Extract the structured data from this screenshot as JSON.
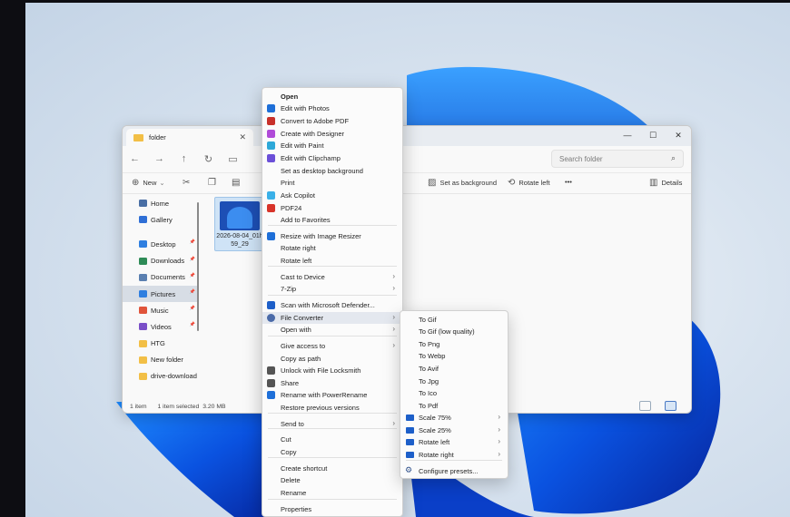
{
  "explorer": {
    "tab_title": "folder",
    "search_placeholder": "Search folder",
    "toolbar": {
      "new_label": "New",
      "set_background_label": "Set as background",
      "rotate_left_label": "Rotate left",
      "more_label": "•••",
      "details_label": "Details"
    },
    "sidebar": {
      "items": [
        {
          "label": "Home",
          "icon": "home-icon",
          "color": "#4a6fa5",
          "pinned": false
        },
        {
          "label": "Gallery",
          "icon": "gallery-icon",
          "color": "#2f6fd6",
          "pinned": false
        },
        {
          "label": "Desktop",
          "icon": "desktop-icon",
          "color": "#2f7fe0",
          "pinned": true
        },
        {
          "label": "Downloads",
          "icon": "download-icon",
          "color": "#2e8b57",
          "pinned": true
        },
        {
          "label": "Documents",
          "icon": "documents-icon",
          "color": "#5a7fb0",
          "pinned": true
        },
        {
          "label": "Pictures",
          "icon": "pictures-icon",
          "color": "#2f7fe0",
          "pinned": true,
          "active": true
        },
        {
          "label": "Music",
          "icon": "music-icon",
          "color": "#e0543a",
          "pinned": true
        },
        {
          "label": "Videos",
          "icon": "videos-icon",
          "color": "#7a4fc8",
          "pinned": true
        },
        {
          "label": "HTG",
          "icon": "folder-icon",
          "color": "#f2bf46",
          "pinned": false
        },
        {
          "label": "New folder",
          "icon": "folder-icon",
          "color": "#f2bf46",
          "pinned": false
        },
        {
          "label": "drive-download",
          "icon": "folder-icon",
          "color": "#f2bf46",
          "pinned": false
        }
      ]
    },
    "file": {
      "name_line1": "2026-08-04_01h",
      "name_line2": "59_29"
    },
    "status": {
      "count": "1 item",
      "selected": "1 item selected",
      "size": "3.20 MB"
    }
  },
  "context_menu": {
    "items": [
      {
        "label": "Open",
        "bold": true,
        "icon": "",
        "color": ""
      },
      {
        "label": "Edit with Photos",
        "icon": "photos-icon",
        "color": "#1e6fd8"
      },
      {
        "label": "Convert to Adobe PDF",
        "icon": "adobe-pdf-icon",
        "color": "#c8302a"
      },
      {
        "label": "Create with Designer",
        "icon": "designer-icon",
        "color": "#b04bd8"
      },
      {
        "label": "Edit with Paint",
        "icon": "paint-icon",
        "color": "#2da8d8"
      },
      {
        "label": "Edit with Clipchamp",
        "icon": "clipchamp-icon",
        "color": "#6b4fd8"
      },
      {
        "label": "Set as desktop background",
        "icon": "",
        "color": ""
      },
      {
        "label": "Print",
        "icon": "",
        "color": ""
      },
      {
        "label": "Ask Copilot",
        "icon": "copilot-icon",
        "color": "#3ab0e8"
      },
      {
        "label": "PDF24",
        "icon": "pdf24-icon",
        "color": "#d8342a"
      },
      {
        "label": "Add to Favorites",
        "icon": "",
        "color": ""
      },
      {
        "label": "Resize with Image Resizer",
        "icon": "image-resizer-icon",
        "color": "#1e6fd8"
      },
      {
        "label": "Rotate right",
        "icon": "",
        "color": ""
      },
      {
        "label": "Rotate left",
        "icon": "",
        "color": ""
      },
      {
        "label": "Cast to Device",
        "icon": "",
        "color": "",
        "submenu": true
      },
      {
        "label": "7-Zip",
        "icon": "",
        "color": "",
        "submenu": true
      },
      {
        "label": "Scan with Microsoft Defender...",
        "icon": "defender-icon",
        "color": "#1e5fc8"
      },
      {
        "label": "File Converter",
        "icon": "file-converter-icon",
        "color": "#4a6aa8",
        "submenu": true,
        "highlighted": true
      },
      {
        "label": "Open with",
        "icon": "",
        "color": "",
        "submenu": true
      },
      {
        "label": "Give access to",
        "icon": "",
        "color": "",
        "submenu": true
      },
      {
        "label": "Copy as path",
        "icon": "",
        "color": ""
      },
      {
        "label": "Unlock with File Locksmith",
        "icon": "lock-icon",
        "color": "#555555"
      },
      {
        "label": "Share",
        "icon": "share-icon",
        "color": "#555555"
      },
      {
        "label": "Rename with PowerRename",
        "icon": "power-rename-icon",
        "color": "#1e6fd8"
      },
      {
        "label": "Restore previous versions",
        "icon": "",
        "color": ""
      },
      {
        "label": "Send to",
        "icon": "",
        "color": "",
        "submenu": true
      },
      {
        "label": "Cut",
        "icon": "",
        "color": ""
      },
      {
        "label": "Copy",
        "icon": "",
        "color": ""
      },
      {
        "label": "Create shortcut",
        "icon": "",
        "color": ""
      },
      {
        "label": "Delete",
        "icon": "",
        "color": ""
      },
      {
        "label": "Rename",
        "icon": "",
        "color": ""
      },
      {
        "label": "Properties",
        "icon": "",
        "color": ""
      }
    ]
  },
  "submenu": {
    "items": [
      {
        "label": "To Gif"
      },
      {
        "label": "To Gif (low quality)"
      },
      {
        "label": "To Png"
      },
      {
        "label": "To Webp"
      },
      {
        "label": "To Avif"
      },
      {
        "label": "To Jpg"
      },
      {
        "label": "To Ico"
      },
      {
        "label": "To Pdf"
      },
      {
        "label": "Scale 75%",
        "folder": true,
        "submenu": true
      },
      {
        "label": "Scale 25%",
        "folder": true,
        "submenu": true
      },
      {
        "label": "Rotate left",
        "folder": true,
        "submenu": true
      },
      {
        "label": "Rotate right",
        "folder": true,
        "submenu": true
      },
      {
        "label": "Configure presets...",
        "gear": true
      }
    ]
  }
}
